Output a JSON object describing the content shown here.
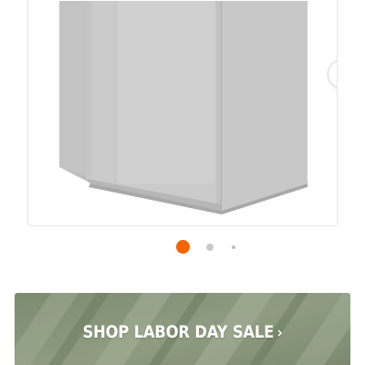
{
  "carousel": {
    "image_alt": "Diagonal corner wall cabinet in gray",
    "next_button": {
      "icon": "chevron-right-icon",
      "aria_label": "Next image"
    },
    "dots": [
      {
        "active": true
      },
      {
        "active": false
      },
      {
        "active": false
      }
    ]
  },
  "banner": {
    "label": "SHOP LABOR DAY SALE",
    "chevron": "›"
  },
  "colors": {
    "accent": "#f96302",
    "dot_inactive": "#c9c9c9",
    "dot_small": "#bdbdbd",
    "cabinet_body": "#cfcfcf",
    "cabinet_shade": "#bdbdbd",
    "banner_base": "#8a9a7e",
    "card_border": "#e6e6e6"
  }
}
